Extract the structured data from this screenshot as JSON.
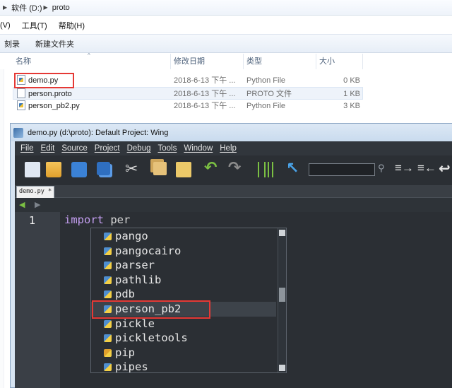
{
  "explorer": {
    "breadcrumb": [
      "软件 (D:)",
      "proto"
    ],
    "menu": [
      "(V)",
      "工具(T)",
      "帮助(H)"
    ],
    "commands": [
      "刻录",
      "新建文件夹"
    ],
    "columns": [
      "名称",
      "修改日期",
      "类型",
      "大小"
    ],
    "files": [
      {
        "name": "demo.py",
        "date": "2018-6-13 下午 ...",
        "type": "Python File",
        "size": "0 KB",
        "icon": "python-file-icon"
      },
      {
        "name": "person.proto",
        "date": "2018-6-13 下午 ...",
        "type": "PROTO 文件",
        "size": "1 KB",
        "icon": "generic-file-icon"
      },
      {
        "name": "person_pb2.py",
        "date": "2018-6-13 下午 ...",
        "type": "Python File",
        "size": "3 KB",
        "icon": "python-file-icon"
      }
    ]
  },
  "wing": {
    "title": "demo.py (d:\\proto): Default Project: Wing",
    "menu": [
      "File",
      "Edit",
      "Source",
      "Project",
      "Debug",
      "Tools",
      "Window",
      "Help"
    ],
    "tab": "demo.py *",
    "search_value": "",
    "line_number": "1",
    "code_keyword": "import",
    "code_text": "per",
    "completions": [
      "pango",
      "pangocairo",
      "parser",
      "pathlib",
      "pdb",
      "person_pb2",
      "pickle",
      "pickletools",
      "pip",
      "pipes"
    ],
    "selected_completion": "person_pb2"
  },
  "colors": {
    "highlight_box": "#e53935",
    "keyword": "#c39ef0",
    "editor_bg": "#2b2f34"
  }
}
